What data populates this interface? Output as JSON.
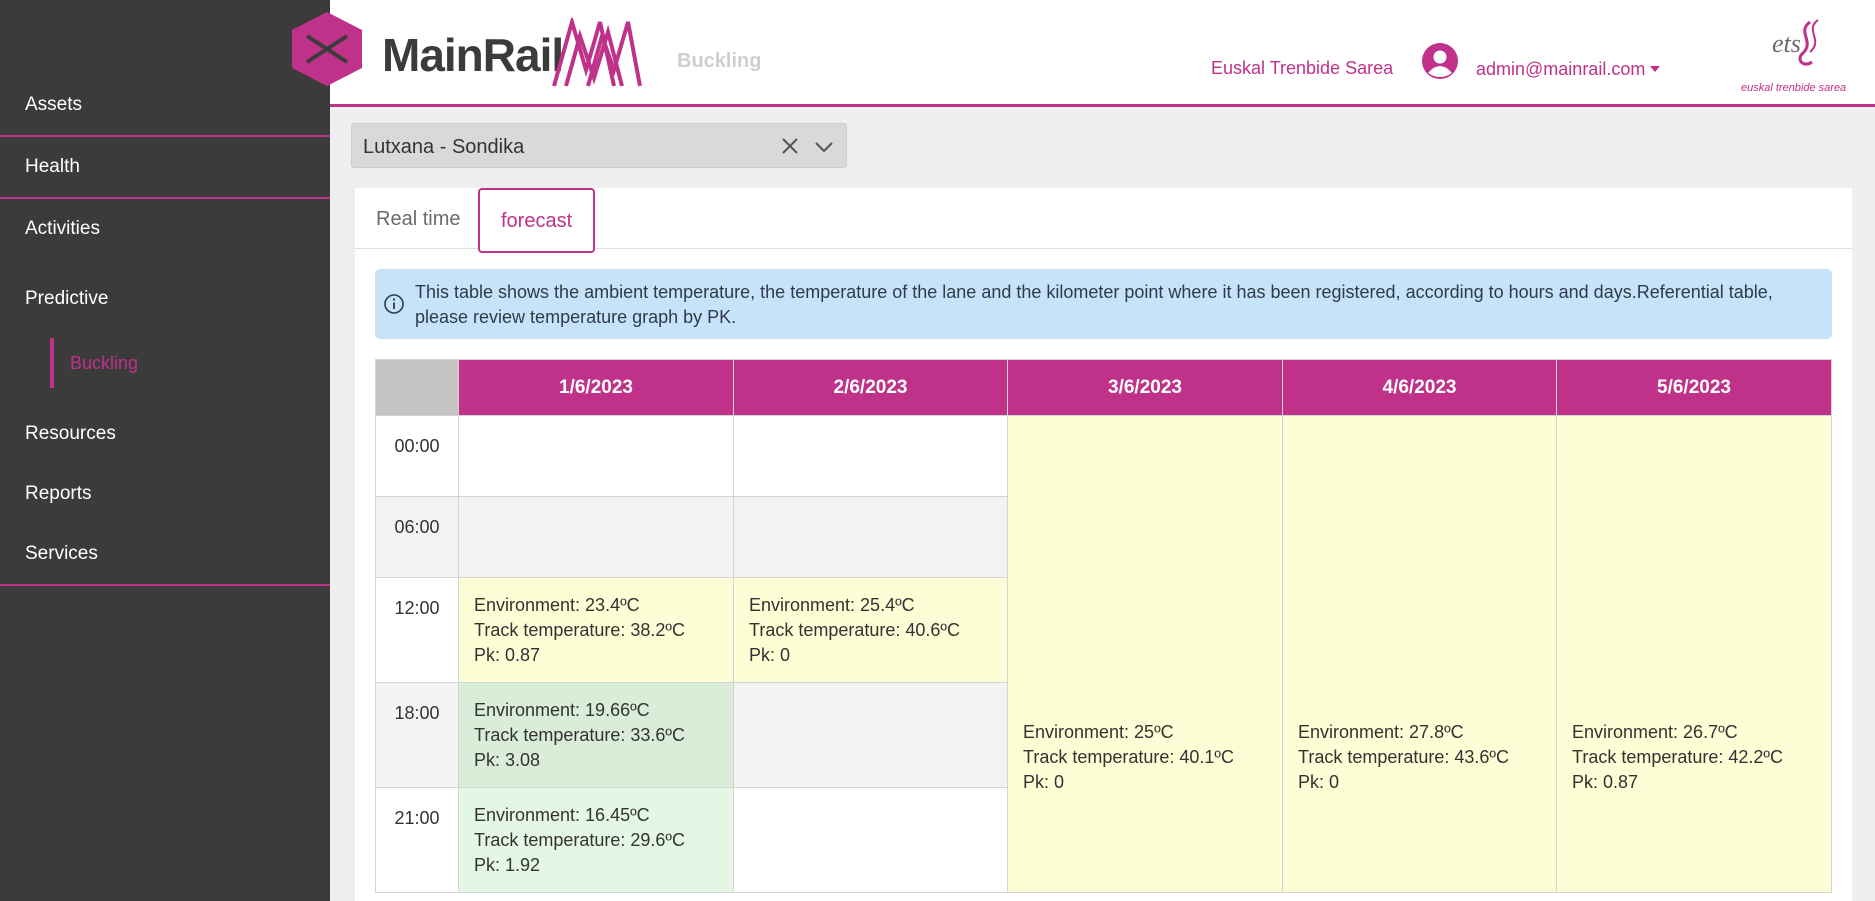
{
  "sidebar": {
    "items": [
      {
        "label": "Assets"
      },
      {
        "label": "Health"
      },
      {
        "label": "Activities"
      },
      {
        "label": "Predictive"
      },
      {
        "label": "Buckling"
      },
      {
        "label": "Resources"
      },
      {
        "label": "Reports"
      },
      {
        "label": "Services"
      }
    ]
  },
  "header": {
    "logo_text": "MainRail",
    "module_title": "Buckling",
    "org_name": "Euskal Trenbide Sarea",
    "user_email": "admin@mainrail.com",
    "partner_logo_text": "ets",
    "partner_caption": "euskal trenbide sarea"
  },
  "line_select": {
    "value": "Lutxana - Sondika"
  },
  "tabs": [
    {
      "label": "Real time"
    },
    {
      "label": "forecast"
    }
  ],
  "info": {
    "text": "This table shows the ambient temperature, the temperature of the lane and the kilometer point where it has been registered, according to hours and days.Referential table, please review temperature graph by PK."
  },
  "table": {
    "dates": [
      "1/6/2023",
      "2/6/2023",
      "3/6/2023",
      "4/6/2023",
      "5/6/2023"
    ],
    "hours": [
      "00:00",
      "06:00",
      "12:00",
      "18:00",
      "21:00"
    ],
    "cells": {
      "d1_12": {
        "env": "Environment: 23.4ºC",
        "track": "Track temperature: 38.2ºC",
        "pk": "Pk: 0.87"
      },
      "d2_12": {
        "env": "Environment: 25.4ºC",
        "track": "Track temperature: 40.6ºC",
        "pk": "Pk: 0"
      },
      "d3": {
        "env": "Environment: 25ºC",
        "track": "Track temperature: 40.1ºC",
        "pk": "Pk: 0"
      },
      "d4": {
        "env": "Environment: 27.8ºC",
        "track": "Track temperature: 43.6ºC",
        "pk": "Pk: 0"
      },
      "d5": {
        "env": "Environment: 26.7ºC",
        "track": "Track temperature: 42.2ºC",
        "pk": "Pk: 0.87"
      },
      "d1_18": {
        "env": "Environment: 19.66ºC",
        "track": "Track temperature: 33.6ºC",
        "pk": "Pk: 3.08"
      },
      "d1_21": {
        "env": "Environment: 16.45ºC",
        "track": "Track temperature: 29.6ºC",
        "pk": "Pk: 1.92"
      }
    }
  },
  "colors": {
    "accent": "#c0318a",
    "sidebar_bg": "#3b3b3b",
    "info_bg": "#c7e3fa",
    "cell_yellow": "#fdfdd6",
    "cell_green": "#d9edd9",
    "cell_light_green": "#e4f7e4"
  }
}
